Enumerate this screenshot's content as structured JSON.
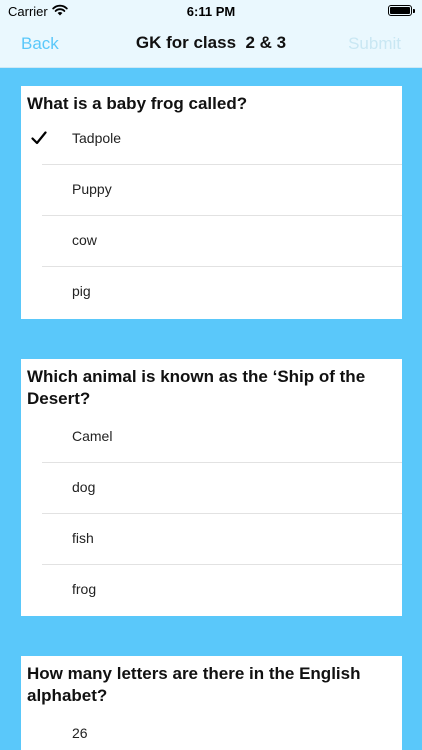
{
  "status_bar": {
    "carrier": "Carrier",
    "time": "6:11 PM"
  },
  "nav": {
    "back": "Back",
    "title": "GK for class  2 & 3",
    "submit": "Submit"
  },
  "questions": [
    {
      "text": "What is a baby frog called?",
      "options": [
        "Tadpole",
        "Puppy",
        "cow",
        "pig"
      ],
      "selected": "Tadpole"
    },
    {
      "text": " Which animal is known as the ‘Ship of the Desert?",
      "options": [
        "Camel",
        "dog",
        "fish",
        "frog"
      ]
    },
    {
      "text": "How many letters are there in the English alphabet?",
      "options": [
        "26"
      ]
    }
  ],
  "colors": {
    "accent": "#5AC8FA",
    "submit_disabled": "#C9E7F3",
    "nav_background": "#EAF8FE"
  },
  "icons": {
    "selected_marker": "checkmark-icon",
    "network": "wifi-icon",
    "power": "battery-icon"
  }
}
